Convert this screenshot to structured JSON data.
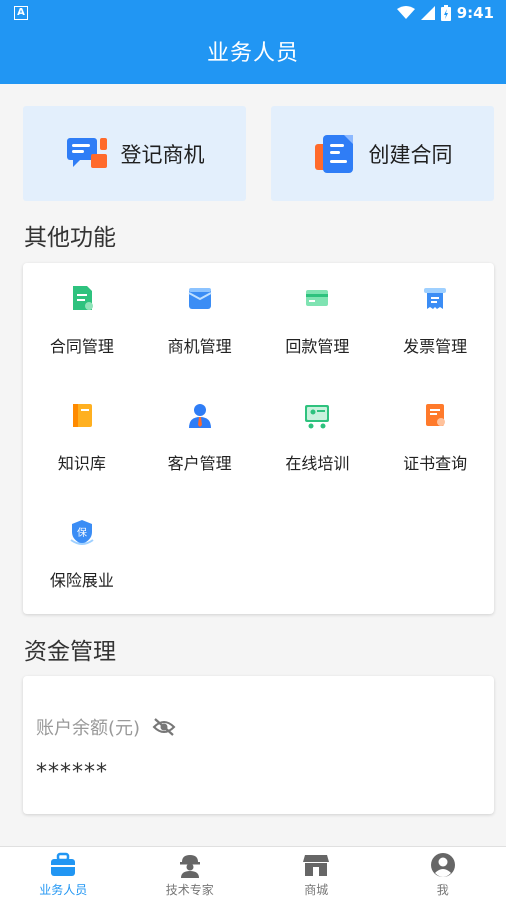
{
  "status_bar": {
    "time": "9:41",
    "left_icon": "A"
  },
  "header": {
    "title": "业务人员"
  },
  "quick_actions": [
    {
      "label": "登记商机",
      "icon": "chat-register-icon"
    },
    {
      "label": "创建合同",
      "icon": "contract-create-icon"
    }
  ],
  "other_functions": {
    "title": "其他功能",
    "items": [
      {
        "label": "合同管理",
        "icon": "contract-icon"
      },
      {
        "label": "商机管理",
        "icon": "opportunity-icon"
      },
      {
        "label": "回款管理",
        "icon": "payment-icon"
      },
      {
        "label": "发票管理",
        "icon": "invoice-icon"
      },
      {
        "label": "知识库",
        "icon": "book-icon"
      },
      {
        "label": "客户管理",
        "icon": "customer-icon"
      },
      {
        "label": "在线培训",
        "icon": "training-icon"
      },
      {
        "label": "证书查询",
        "icon": "certificate-icon"
      },
      {
        "label": "保险展业",
        "icon": "insurance-icon"
      }
    ]
  },
  "funds": {
    "title": "资金管理",
    "balance_label": "账户余额(元)",
    "balance_value": "******"
  },
  "bottom_nav": [
    {
      "label": "业务人员",
      "icon": "briefcase-icon",
      "active": true
    },
    {
      "label": "技术专家",
      "icon": "engineer-icon",
      "active": false
    },
    {
      "label": "商城",
      "icon": "store-icon",
      "active": false
    },
    {
      "label": "我",
      "icon": "profile-icon",
      "active": false
    }
  ],
  "colors": {
    "primary": "#2196f3",
    "card_tint": "#e3effc"
  }
}
